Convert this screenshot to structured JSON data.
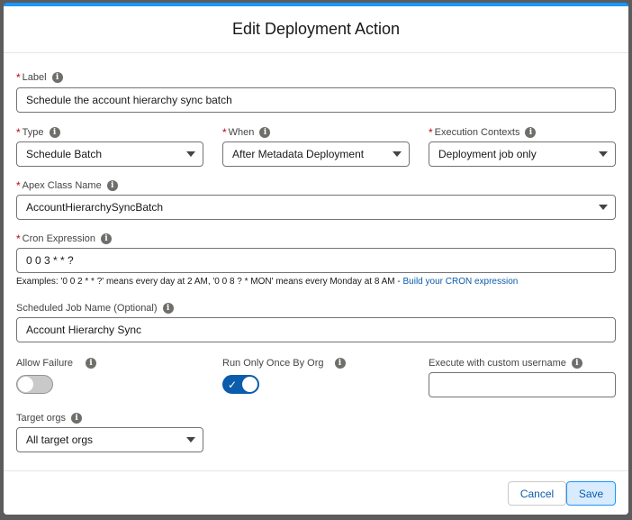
{
  "modal": {
    "title": "Edit Deployment Action"
  },
  "fields": {
    "label": {
      "label": "Label",
      "required": "*",
      "value": "Schedule the account hierarchy sync batch"
    },
    "type": {
      "label": "Type",
      "required": "*",
      "value": "Schedule Batch"
    },
    "when": {
      "label": "When",
      "required": "*",
      "value": "After Metadata Deployment"
    },
    "contexts": {
      "label": "Execution Contexts",
      "required": "*",
      "value": "Deployment job only"
    },
    "apex": {
      "label": "Apex Class Name",
      "required": "*",
      "value": "AccountHierarchySyncBatch"
    },
    "cron": {
      "label": "Cron Expression",
      "required": "*",
      "value": "0 0 3 * * ?",
      "hint": "Examples: '0 0 2 * * ?' means every day at 2 AM, '0 0 8 ? * MON' means every Monday at 8 AM - ",
      "hint_link": "Build your CRON expression"
    },
    "job_name": {
      "label": "Scheduled Job Name (Optional)",
      "value": "Account Hierarchy Sync"
    },
    "allow_failure": {
      "label": "Allow Failure",
      "checked": false
    },
    "run_once": {
      "label": "Run Only Once By Org",
      "checked": true,
      "check_glyph": "✓"
    },
    "custom_user": {
      "label": "Execute with custom username",
      "value": ""
    },
    "target_orgs": {
      "label": "Target orgs",
      "value": "All target orgs"
    }
  },
  "icons": {
    "info": "i"
  },
  "footer": {
    "cancel_label": "Cancel",
    "save_label": "Save"
  },
  "colors": {
    "brand": "#0b5cab",
    "accent": "#1b96ff",
    "required": "#ba0517"
  }
}
